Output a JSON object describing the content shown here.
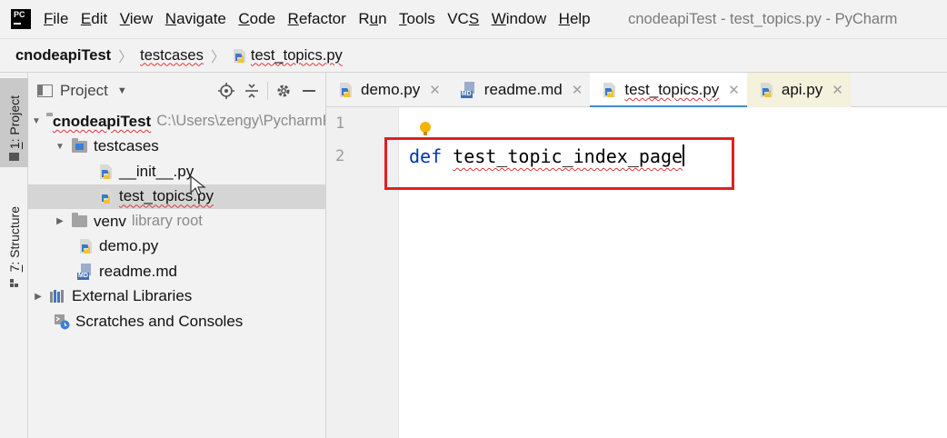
{
  "menubar": {
    "items": [
      {
        "label": "File",
        "mn": "F",
        "rest": "ile"
      },
      {
        "label": "Edit",
        "mn": "E",
        "rest": "dit"
      },
      {
        "label": "View",
        "mn": "V",
        "rest": "iew"
      },
      {
        "label": "Navigate",
        "mn": "N",
        "rest": "avigate"
      },
      {
        "label": "Code",
        "mn": "C",
        "rest": "ode"
      },
      {
        "label": "Refactor",
        "mn": "R",
        "rest": "efactor"
      },
      {
        "label": "Run",
        "pre": "R",
        "mn": "u",
        "rest": "n"
      },
      {
        "label": "Tools",
        "mn": "T",
        "rest": "ools"
      },
      {
        "label": "VCS",
        "pre": "VC",
        "mn": "S",
        "rest": ""
      },
      {
        "label": "Window",
        "mn": "W",
        "rest": "indow"
      },
      {
        "label": "Help",
        "mn": "H",
        "rest": "elp"
      }
    ],
    "window_title": "cnodeapiTest - test_topics.py - PyCharm"
  },
  "breadcrumb": {
    "project": "cnodeapiTest",
    "folder": "testcases",
    "file": "test_topics.py"
  },
  "toolstrip": {
    "project_tab": {
      "mn": "1",
      "rest": ": Project"
    },
    "structure_tab": {
      "mn": "7",
      "rest": ": Structure"
    }
  },
  "project_panel": {
    "title": "Project",
    "tree": {
      "root": {
        "label": "cnodeapiTest",
        "path": "C:\\Users\\zengy\\PycharmProjects\\cnodeapiTest"
      },
      "testcases": "testcases",
      "init_file": "__init__.py",
      "test_file": "test_topics.py",
      "venv": {
        "label": "venv",
        "hint": "library root"
      },
      "demo_file": "demo.py",
      "readme_file": "readme.md",
      "external": "External Libraries",
      "scratches": "Scratches and Consoles"
    }
  },
  "tabs": [
    {
      "label": "demo.py",
      "icon": "python-file-icon"
    },
    {
      "label": "readme.md",
      "icon": "markdown-file-icon"
    },
    {
      "label": "test_topics.py",
      "icon": "python-file-icon",
      "active": true
    },
    {
      "label": "api.py",
      "icon": "python-file-icon"
    }
  ],
  "editor": {
    "line_numbers": [
      "1",
      "2"
    ],
    "code": {
      "keyword": "def",
      "function_name": "test_topic_index_page"
    }
  },
  "colors": {
    "keyword": "#0033b3",
    "active_tab_underline": "#4a88c7",
    "highlight_box": "#e02020",
    "error_squiggle": "#d83b3b"
  }
}
